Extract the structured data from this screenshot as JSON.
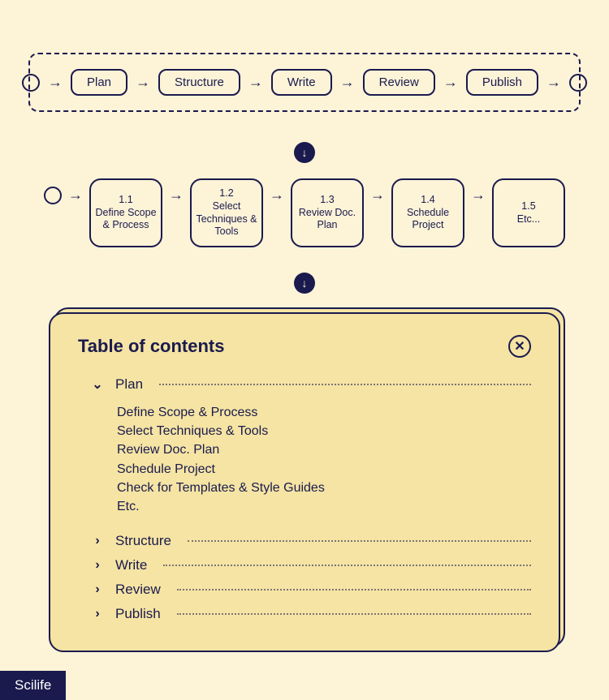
{
  "flow_top": {
    "steps": [
      "Plan",
      "Structure",
      "Write",
      "Review",
      "Publish"
    ]
  },
  "flow_detail": {
    "items": [
      {
        "num": "1.1",
        "label": "Define Scope & Process"
      },
      {
        "num": "1.2",
        "label": "Select Techniques & Tools"
      },
      {
        "num": "1.3",
        "label": "Review Doc. Plan"
      },
      {
        "num": "1.4",
        "label": "Schedule Project"
      },
      {
        "num": "1.5",
        "label": "Etc..."
      }
    ]
  },
  "toc": {
    "title": "Table of contents",
    "sections": [
      {
        "label": "Plan",
        "expanded": true,
        "items": [
          "Define Scope & Process",
          "Select Techniques & Tools",
          "Review Doc. Plan",
          "Schedule Project",
          "Check for Templates & Style Guides",
          "Etc."
        ]
      },
      {
        "label": "Structure",
        "expanded": false
      },
      {
        "label": "Write",
        "expanded": false
      },
      {
        "label": "Review",
        "expanded": false
      },
      {
        "label": "Publish",
        "expanded": false
      }
    ]
  },
  "brand": "Scilife"
}
